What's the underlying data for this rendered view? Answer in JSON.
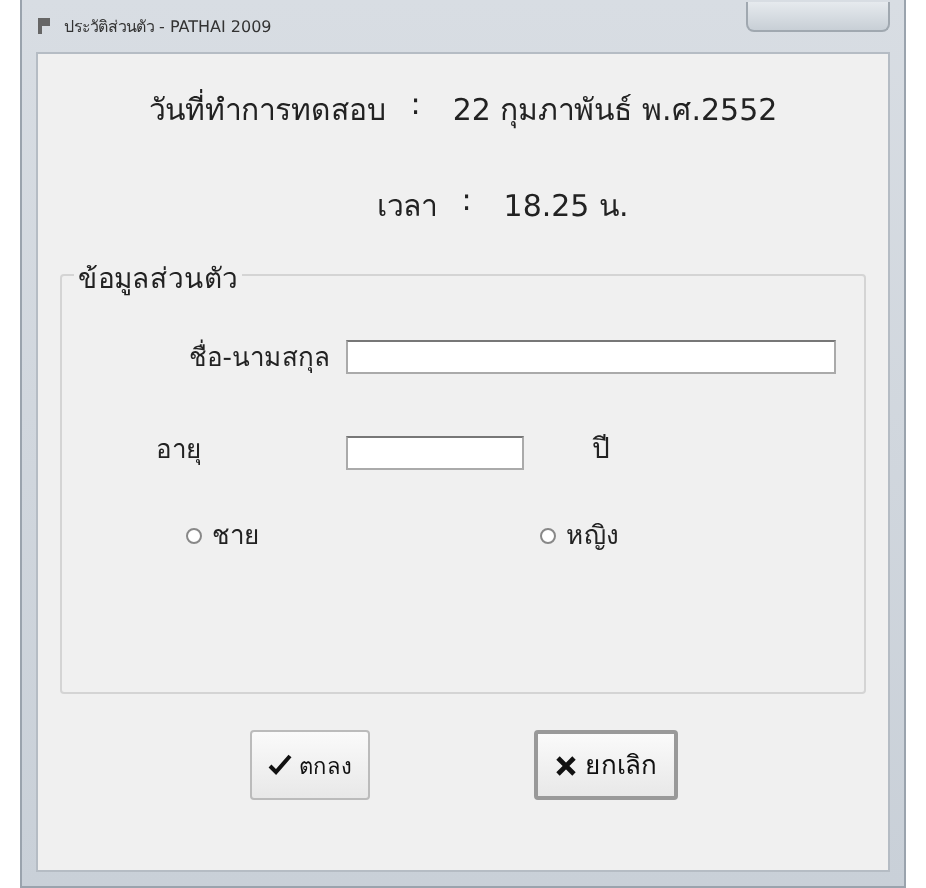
{
  "window": {
    "title": "ประวัติส่วนตัว - PATHAI 2009"
  },
  "test_date": {
    "label": "วันที่ทำการทดสอบ",
    "separator": ":",
    "value": "22 กุมภาพันธ์ พ.ศ.2552"
  },
  "test_time": {
    "label": "เวลา",
    "separator": ":",
    "value": "18.25 น."
  },
  "personal_info": {
    "title": "ข้อมูลส่วนตัว",
    "name_field": {
      "label": "ชื่อ-นามสกุล"
    },
    "age_field": {
      "label": "อายุ",
      "unit": "ปี"
    },
    "gender": [
      {
        "label": "ชาย",
        "selected": false
      },
      {
        "label": "หญิง",
        "selected": false
      }
    ]
  },
  "buttons": [
    {
      "kind": "ok",
      "label": "ตกลง"
    },
    {
      "kind": "cancel",
      "label": "ยกเลิก"
    }
  ]
}
